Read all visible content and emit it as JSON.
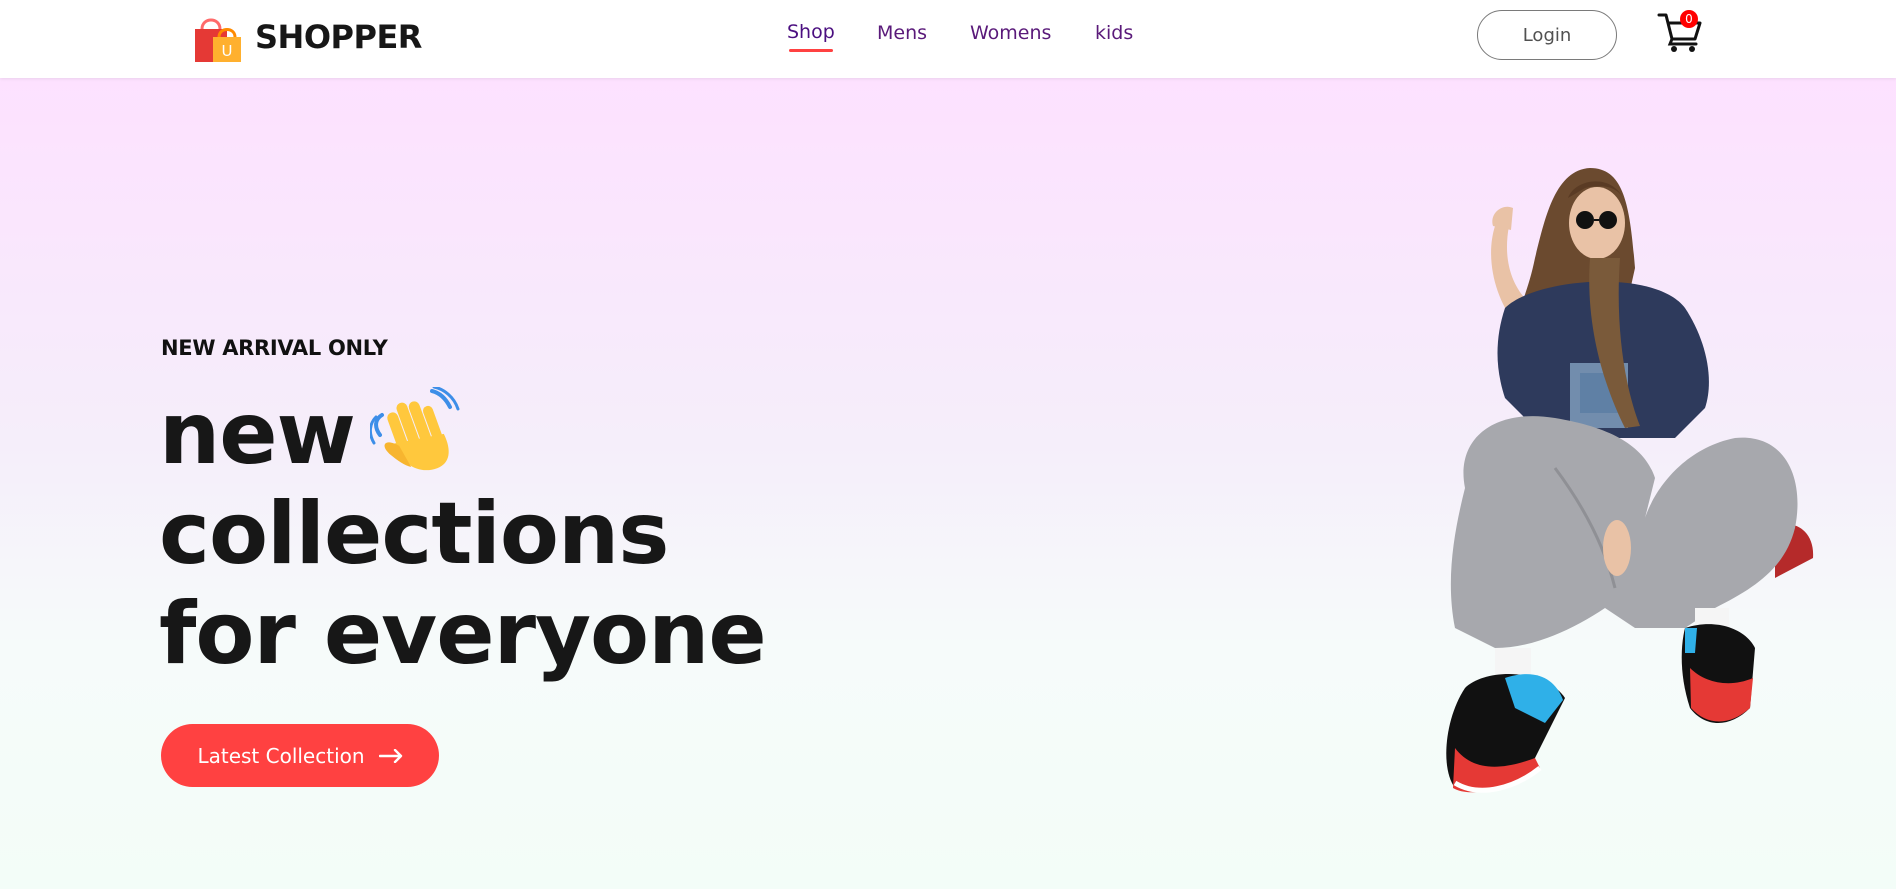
{
  "brand": {
    "name": "SHOPPER",
    "logo_letter": "U"
  },
  "nav": {
    "items": [
      {
        "label": "Shop",
        "active": true
      },
      {
        "label": "Mens",
        "active": false
      },
      {
        "label": "Womens",
        "active": false
      },
      {
        "label": "kids",
        "active": false
      }
    ]
  },
  "header": {
    "login_label": "Login",
    "cart_count": "0"
  },
  "hero": {
    "eyebrow": "NEW ARRIVAL ONLY",
    "headline": [
      "new",
      "collections",
      "for everyone"
    ],
    "cta_label": "Latest Collection",
    "hand_icon": "waving-hand",
    "cta_icon": "arrow-right"
  },
  "colors": {
    "accent": "#ff4141",
    "nav_text": "#5a1a7a",
    "hero_gradient_top": "#fde1ff",
    "hero_gradient_bottom": "#f3fdf8"
  }
}
